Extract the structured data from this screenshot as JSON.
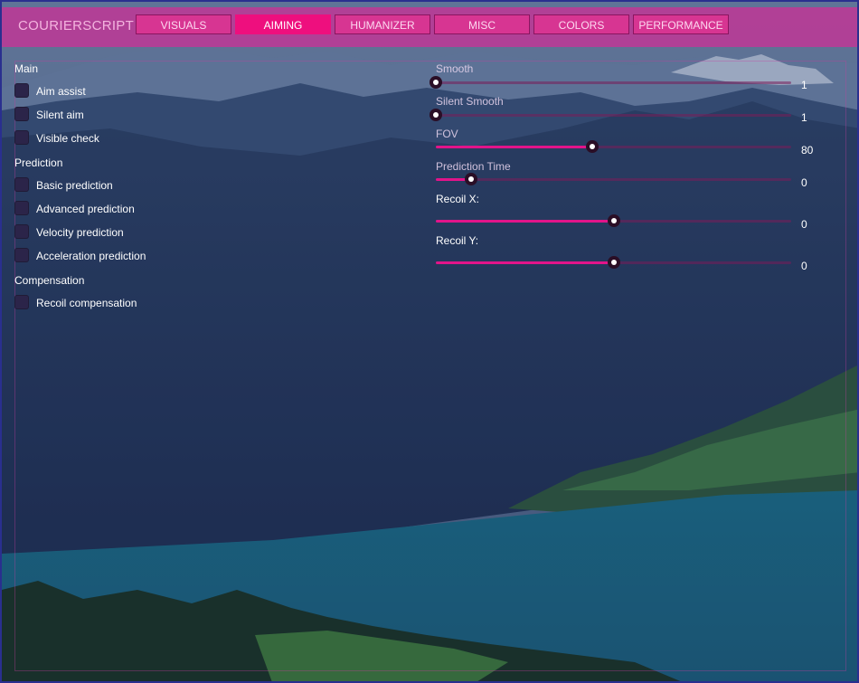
{
  "app": {
    "title": "COURIERSCRIPT"
  },
  "tabs": [
    {
      "label": "VISUALS",
      "active": false
    },
    {
      "label": "AIMING",
      "active": true
    },
    {
      "label": "HUMANIZER",
      "active": false
    },
    {
      "label": "MISC",
      "active": false
    },
    {
      "label": "COLORS",
      "active": false
    },
    {
      "label": "PERFORMANCE",
      "active": false
    }
  ],
  "sections": {
    "main": {
      "title": "Main",
      "items": [
        {
          "label": "Aim assist",
          "checked": false
        },
        {
          "label": "Silent aim",
          "checked": false
        },
        {
          "label": "Visible check",
          "checked": false
        }
      ]
    },
    "prediction": {
      "title": "Prediction",
      "items": [
        {
          "label": "Basic prediction",
          "checked": false
        },
        {
          "label": "Advanced prediction",
          "checked": false
        },
        {
          "label": "Velocity prediction",
          "checked": false
        },
        {
          "label": "Acceleration prediction",
          "checked": false
        }
      ]
    },
    "compensation": {
      "title": "Compensation",
      "items": [
        {
          "label": "Recoil compensation",
          "checked": false
        }
      ]
    }
  },
  "sliders": [
    {
      "label": "Smooth",
      "value": "1",
      "fill": 0.0
    },
    {
      "label": "Silent Smooth",
      "value": "1",
      "fill": 0.0
    },
    {
      "label": "FOV",
      "value": "80",
      "fill": 0.44
    },
    {
      "label": "Prediction Time",
      "value": "0",
      "fill": 0.1
    },
    {
      "label": "Recoil X:",
      "value": "0",
      "fill": 0.5
    },
    {
      "label": "Recoil Y:",
      "value": "0",
      "fill": 0.5
    }
  ],
  "colors": {
    "accent": "#ee0f7e",
    "header": "#c83296",
    "checkbox": "#2b2449"
  },
  "icons": {
    "slider_thumb": "slider-thumb-icon"
  }
}
